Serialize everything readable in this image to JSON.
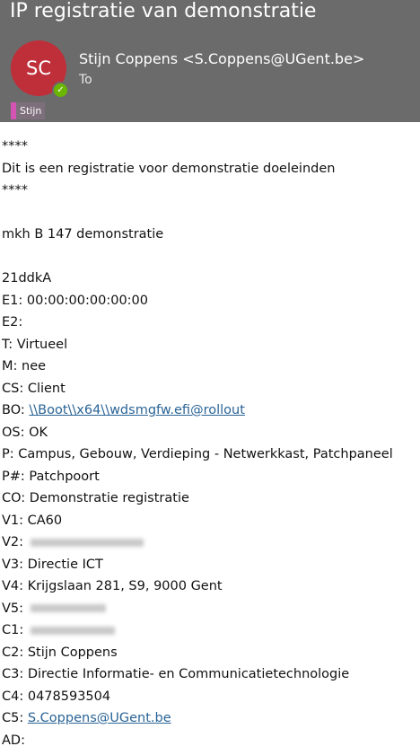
{
  "header": {
    "subject": "IP registratie van demonstratie",
    "avatar_initials": "SC",
    "sender": "Stijn Coppens <S.Coppens@UGent.be>",
    "to_label": "To",
    "category_tag": "Stijn",
    "status_icon": "check-icon",
    "colors": {
      "header_bg": "#6b6b6b",
      "avatar_bg": "#bf2f3a",
      "presence": "#6bb700",
      "tag_color": "#d354b3"
    }
  },
  "body": {
    "stars_top": "****",
    "intro": "Dit is een registratie voor demonstratie doeleinden",
    "stars_bottom": "****",
    "title_line": "mkh B 147 demonstratie",
    "id_line": "21ddkA",
    "e1": "E1: 00:00:00:00:00:00",
    "e2": "E2:",
    "t": "T: Virtueel",
    "m": "M: nee",
    "cs": "CS: Client",
    "bo_prefix": "BO: ",
    "bo_link": "\\\\Boot\\\\x64\\\\wdsmgfw.efi@rollout",
    "os": "OS: OK",
    "p": "P: Campus, Gebouw, Verdieping - Netwerkkast, Patchpaneel",
    "pnum": "P#: Patchpoort",
    "co": "CO: Demonstratie registratie",
    "v1": "V1: CA60",
    "v2": "V2:",
    "v3": "V3: Directie ICT",
    "v4": "V4: Krijgslaan 281, S9, 9000 Gent",
    "v5": "V5:",
    "c1": "C1:",
    "c2": "C2: Stijn Coppens",
    "c3": "C3: Directie Informatie- en Communicatietechnologie",
    "c4": "C4: 0478593504",
    "c5_prefix": "C5: ",
    "c5_link": "S.Coppens@UGent.be",
    "ad": "AD:"
  }
}
